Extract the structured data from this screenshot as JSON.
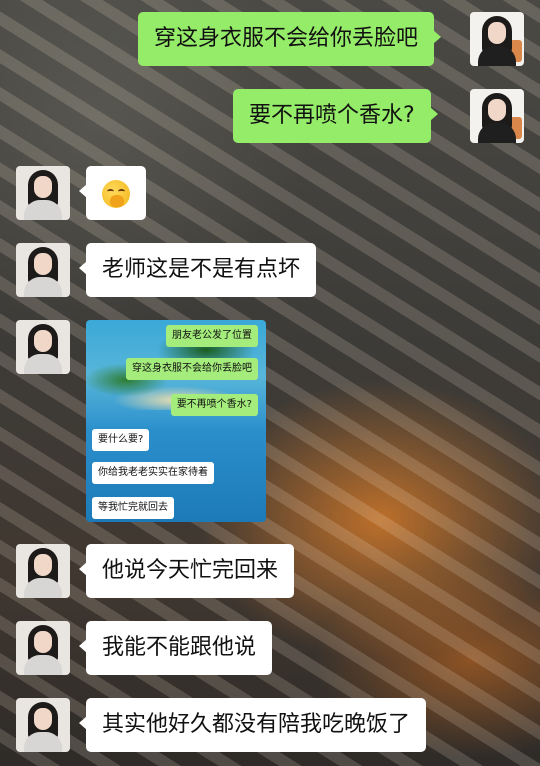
{
  "messages": [
    {
      "side": "right",
      "text": "穿这身衣服不会给你丢脸吧"
    },
    {
      "side": "right",
      "text": "要不再喷个香水?"
    },
    {
      "side": "left",
      "emoji": "facepalm-emoji"
    },
    {
      "side": "left",
      "text": "老师这是不是有点坏"
    },
    {
      "side": "left",
      "screenshot": {
        "lines": [
          {
            "side": "right",
            "text": "朋友老公发了位置"
          },
          {
            "side": "right",
            "text": "穿这身衣服不会给你丢脸吧"
          },
          {
            "side": "right",
            "text": "要不再喷个香水?"
          },
          {
            "side": "left",
            "text": "要什么要?"
          },
          {
            "side": "left",
            "text": "你给我老老实实在家待着"
          },
          {
            "side": "left",
            "text": "等我忙完就回去"
          }
        ]
      }
    },
    {
      "side": "left",
      "text": "他说今天忙完回来"
    },
    {
      "side": "left",
      "text": "我能不能跟他说"
    },
    {
      "side": "left",
      "text": "其实他好久都没有陪我吃晚饭了"
    }
  ],
  "colors": {
    "self_bubble": "#95ec69",
    "other_bubble": "#ffffff"
  }
}
